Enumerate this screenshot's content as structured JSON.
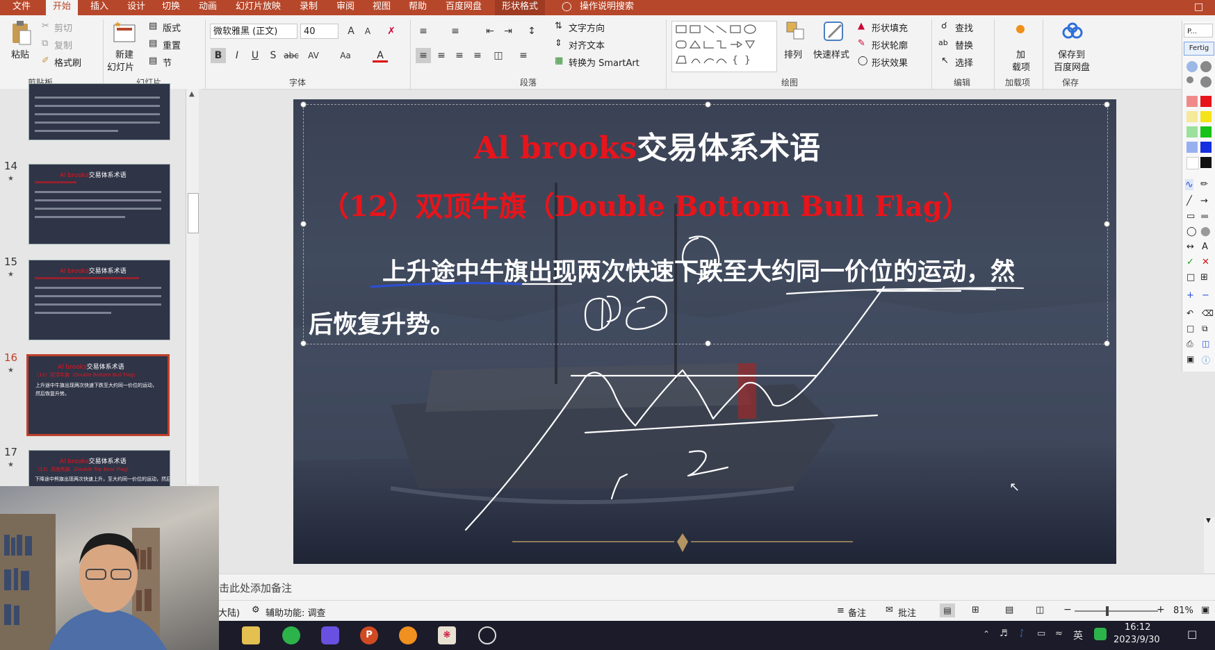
{
  "menu_tabs": [
    "文件",
    "开始",
    "插入",
    "设计",
    "切换",
    "动画",
    "幻灯片放映",
    "录制",
    "审阅",
    "视图",
    "帮助",
    "百度网盘",
    "形状格式"
  ],
  "active_tab": "开始",
  "tell_me": "操作说明搜索",
  "ribbon": {
    "clipboard": {
      "paste": "粘贴",
      "cut": "剪切",
      "copy": "复制",
      "format_painter": "格式刷",
      "group": "剪贴板"
    },
    "slides": {
      "new_slide_1": "新建",
      "new_slide_2": "幻灯片",
      "layout": "版式",
      "reset": "重置",
      "section": "节",
      "group": "幻灯片"
    },
    "font": {
      "name": "微软雅黑 (正文)",
      "size": "40",
      "group": "字体"
    },
    "paragraph": {
      "text_direction": "文字方向",
      "align_text": "对齐文本",
      "smartart": "转换为 SmartArt",
      "group": "段落"
    },
    "drawing": {
      "arrange": "排列",
      "quick_styles": "快速样式",
      "shape_fill": "形状填充",
      "shape_outline": "形状轮廓",
      "shape_effects": "形状效果",
      "group": "绘图"
    },
    "editing": {
      "find": "查找",
      "replace": "替换",
      "select": "选择",
      "group": "编辑"
    },
    "addins": {
      "label_1": "加",
      "label_2": "载项",
      "group": "加载项"
    },
    "save": {
      "label_1": "保存到",
      "label_2": "百度网盘",
      "group": "保存"
    }
  },
  "thumbnails": [
    {
      "num": "14",
      "title_red": "Al brooks",
      "title_white": "交易体系术语",
      "selected": false
    },
    {
      "num": "15",
      "title_red": "Al brooks",
      "title_white": "交易体系术语",
      "selected": false
    },
    {
      "num": "16",
      "title_red": "Al brooks",
      "title_white": "交易体系术语",
      "selected": true
    },
    {
      "num": "17",
      "title_red": "Al brooks",
      "title_white": "交易体系术语",
      "selected": false
    }
  ],
  "thumb_16_sub": "（12）双顶牛旗（Double Bottom Bull Flag）",
  "thumb_16_body": "上升途中牛旗出现两次快速下跌至大约同一价位的运动，然后恢复升势。",
  "thumb_17_sub": "（13）双底熊旗（Double Top Bear Flag）",
  "thumb_17_body": "下降途中熊旗出现两次快速上升，至大约同一价位的运动，然后",
  "slide": {
    "title_red": "Al brooks",
    "title_white": "交易体系术语",
    "subtitle": "（12）双顶牛旗（Double Bottom Bull Flag）",
    "body_line1": "上升途中牛旗出现两次快速下跌至大约同一价位的运动，然",
    "body_line2": "后恢复升势。",
    "annotation_1": "1",
    "annotation_2": "2"
  },
  "right_panel": {
    "search": "P...",
    "button": "Fertig"
  },
  "notes_placeholder": "单击此处添加备注",
  "status": {
    "language": "大陆)",
    "accessibility": "辅助功能: 调查",
    "notes": "备注",
    "comments": "批注",
    "zoom": "81%"
  },
  "taskbar": {
    "time": "16:12",
    "date": "2023/9/30",
    "ime": "英"
  },
  "colors": {
    "accent": "#b7472a",
    "slide_red": "#e8141b",
    "slide_bg": "#3b4356"
  }
}
